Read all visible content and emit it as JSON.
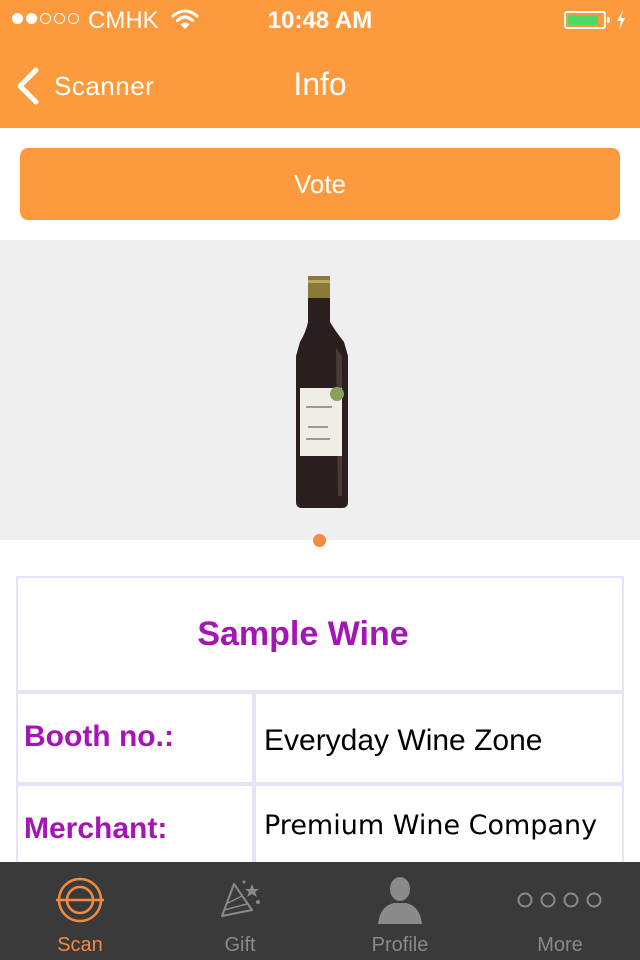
{
  "status_bar": {
    "carrier": "CMHK",
    "time": "10:48 AM",
    "signal_bars_filled": 2,
    "signal_bars_total": 5
  },
  "nav": {
    "back_label": "Scanner",
    "title": "Info"
  },
  "vote_button": "Vote",
  "gallery": {
    "page_count": 1,
    "current_page": 1
  },
  "info": {
    "name": "Sample Wine",
    "rows": [
      {
        "label": "Booth no.:",
        "value": "Everyday Wine Zone"
      },
      {
        "label": "Merchant:",
        "value": "Premium Wine Company"
      }
    ]
  },
  "tabs": [
    {
      "label": "Scan",
      "icon": "target-icon",
      "active": true
    },
    {
      "label": "Gift",
      "icon": "gift-icon",
      "active": false
    },
    {
      "label": "Profile",
      "icon": "person-icon",
      "active": false
    },
    {
      "label": "More",
      "icon": "more-dots-icon",
      "active": false
    }
  ],
  "colors": {
    "accent": "#FE9A3E",
    "title_purple": "#A515B5",
    "tabbar_bg": "#3A3A3A",
    "tab_active": "#F58B40",
    "tab_inactive": "#8A8A8A",
    "battery": "#4CD964"
  }
}
